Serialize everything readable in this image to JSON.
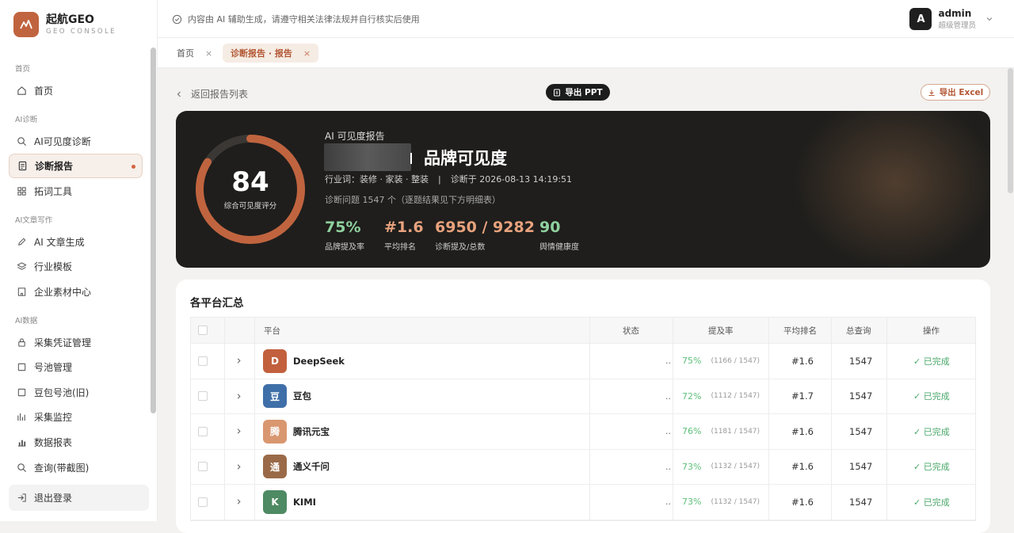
{
  "brand": {
    "name": "起航GEO",
    "sub": "GEO CONSOLE"
  },
  "sidebar": {
    "groups": [
      "首页",
      "AI诊断",
      "AI文章写作",
      "AI数据"
    ],
    "items": [
      {
        "label": "首页",
        "icon": "home-icon"
      },
      {
        "label": "AI可见度诊断",
        "icon": "search-icon"
      },
      {
        "label": "诊断报告",
        "icon": "report-icon",
        "active": true
      },
      {
        "label": "拓词工具",
        "icon": "grid-icon"
      },
      {
        "label": "AI 文章生成",
        "icon": "pen-icon"
      },
      {
        "label": "行业模板",
        "icon": "layers-icon"
      },
      {
        "label": "企业素材中心",
        "icon": "building-icon"
      },
      {
        "label": "采集凭证管理",
        "icon": "key-icon"
      },
      {
        "label": "号池管理",
        "icon": "square-icon"
      },
      {
        "label": "豆包号池(旧)",
        "icon": "square-icon"
      },
      {
        "label": "采集监控",
        "icon": "monitor-icon"
      },
      {
        "label": "数据报表",
        "icon": "bar-chart-icon"
      },
      {
        "label": "查询(带截图)",
        "icon": "search-icon"
      }
    ],
    "logout": "退出登录"
  },
  "topbar": {
    "notice": "内容由 AI 辅助生成，请遵守相关法律法规并自行核实后使用",
    "user": {
      "avatar": "A",
      "name": "admin",
      "role": "超级管理员"
    }
  },
  "tabs": [
    {
      "label": "首页",
      "close": "×"
    },
    {
      "label": "诊断报告 · 报告",
      "close": "×",
      "active": true
    }
  ],
  "toolbar": {
    "back": "返回报告列表",
    "export_ppt": "导出 PPT",
    "export_excel": "导出 Excel"
  },
  "hero": {
    "score": 84,
    "score_value": "84",
    "score_label": "综合可见度评分",
    "report_type": "AI 可见度报告",
    "brand_title": "品牌可见度",
    "industry": "行业词：装修 · 家装 · 整装",
    "diag_time": "诊断于 2026-08-13 14:19:51",
    "questions": "诊断问题 1547 个（逐题结果见下方明细表）",
    "score_fraction": 0.84,
    "stats": [
      {
        "value": "75%",
        "label": "品牌提及率",
        "color": "#8fd19e"
      },
      {
        "value": "#1.6",
        "label": "平均排名",
        "color": "#e8a27d"
      },
      {
        "value": "6950 / 9282",
        "label": "诊断提及/总数",
        "color": "#e8a27d"
      },
      {
        "value": "90",
        "label": "舆情健康度",
        "color": "#8fd19e"
      }
    ]
  },
  "summary": {
    "title": "各平台汇总",
    "columns": [
      "平台",
      "状态",
      "提及率",
      "平均排名",
      "总查询",
      "操作"
    ],
    "rows": [
      {
        "avatar": "D",
        "color": "#c2603d",
        "name": "DeepSeek",
        "status": "..",
        "rate": "75%",
        "ratio": "(1166 / 1547)",
        "rank": "#1.6",
        "total": "1547",
        "action": "✓ 已完成"
      },
      {
        "avatar": "豆",
        "color": "#3f6fa8",
        "name": "豆包",
        "status": "..",
        "rate": "72%",
        "ratio": "(1112 / 1547)",
        "rank": "#1.7",
        "total": "1547",
        "action": "✓ 已完成"
      },
      {
        "avatar": "腾",
        "color": "#d99770",
        "name": "腾讯元宝",
        "status": "..",
        "rate": "76%",
        "ratio": "(1181 / 1547)",
        "rank": "#1.6",
        "total": "1547",
        "action": "✓ 已完成"
      },
      {
        "avatar": "通",
        "color": "#9a6a48",
        "name": "通义千问",
        "status": "..",
        "rate": "73%",
        "ratio": "(1132 / 1547)",
        "rank": "#1.6",
        "total": "1547",
        "action": "✓ 已完成"
      },
      {
        "avatar": "K",
        "color": "#4e8a63",
        "name": "KIMI",
        "status": "..",
        "rate": "73%",
        "ratio": "(1132 / 1547)",
        "rank": "#1.6",
        "total": "1547",
        "action": "✓ 已完成"
      }
    ]
  }
}
